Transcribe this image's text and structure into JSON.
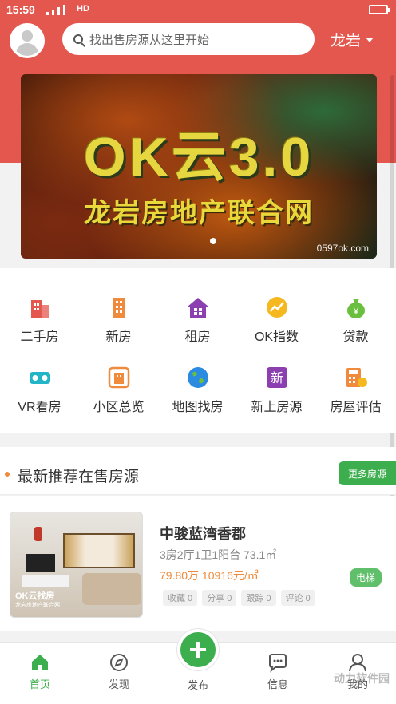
{
  "status_bar": {
    "time": "15:59",
    "network": "HD"
  },
  "header": {
    "search_placeholder": "找出售房源从这里开始",
    "city": "龙岩"
  },
  "banner": {
    "title": "OK云3.0",
    "subtitle": "龙岩房地产联合网",
    "watermark": "0597ok.com"
  },
  "menu": {
    "items": [
      {
        "label": "二手房",
        "icon": "building-icon",
        "color": "#e4574e"
      },
      {
        "label": "新房",
        "icon": "tower-icon",
        "color": "#f08a3c"
      },
      {
        "label": "租房",
        "icon": "house-icon",
        "color": "#8b3fb0"
      },
      {
        "label": "OK指数",
        "icon": "chart-icon",
        "color": "#f5b81f"
      },
      {
        "label": "贷款",
        "icon": "money-bag-icon",
        "color": "#6bbf3e"
      },
      {
        "label": "VR看房",
        "icon": "vr-icon",
        "color": "#22b4c7"
      },
      {
        "label": "小区总览",
        "icon": "community-icon",
        "color": "#f08a3c"
      },
      {
        "label": "地图找房",
        "icon": "globe-icon",
        "color": "#2b8be0"
      },
      {
        "label": "新上房源",
        "icon": "new-badge-icon",
        "color": "#8b3fb0",
        "glyph": "新"
      },
      {
        "label": "房屋评估",
        "icon": "calculator-icon",
        "color": "#f08a3c"
      }
    ]
  },
  "section": {
    "title": "最新推荐在售房源",
    "more": "更多房源"
  },
  "listing": {
    "name": "中骏蓝湾香郡",
    "spec": "3房2厅1卫1阳台 73.1㎡",
    "price": "79.80万 10916元/㎡",
    "tag": "电梯",
    "photo_logo": "OK云找房",
    "photo_logo_sub": "龙岩房地产联合网",
    "stats": [
      "收藏 0",
      "分享 0",
      "跟踪 0",
      "评论 0"
    ]
  },
  "tabbar": {
    "home": "首页",
    "discover": "发现",
    "publish": "发布",
    "messages": "信息",
    "mine": "我的",
    "active_color": "#3cae4e"
  },
  "watermark_brand": "动力软件园"
}
